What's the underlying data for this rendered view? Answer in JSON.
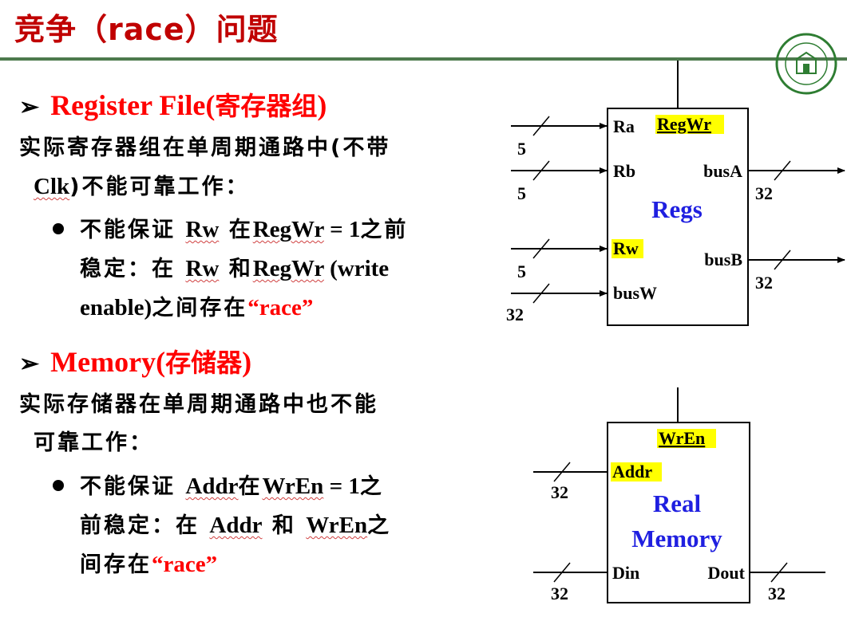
{
  "slide": {
    "title": "竞争（race）问题"
  },
  "sections": [
    {
      "heading_latin": "Register File(",
      "heading_cjk": "寄存器组",
      "heading_close": ")",
      "para_a": "实际寄存器组在单周期通路中(不带",
      "para_b_link": "Clk",
      "para_b_rest": ")不能可靠工作：",
      "bullet": {
        "l1_a": "不能保证 ",
        "l1_b": "Rw",
        "l1_c": " 在",
        "l1_d": "RegWr",
        "l1_e": " = 1",
        "l1_f": "之前",
        "l2_a": "稳定：在 ",
        "l2_b": "Rw",
        "l2_c": " 和",
        "l2_d": "RegWr",
        "l2_e": " (write",
        "l3_a": "enable)",
        "l3_b": "之间存在",
        "l3_c": "“race”"
      }
    },
    {
      "heading_latin": "Memory(",
      "heading_cjk": "存储器",
      "heading_close": ")",
      "para_a": "实际存储器在单周期通路中也不能",
      "para_b": "可靠工作：",
      "bullet": {
        "l1_a": "不能保证 ",
        "l1_b": "Addr",
        "l1_c": "在",
        "l1_d": "WrEn",
        "l1_e": " = 1",
        "l1_f": "之",
        "l2_a": "前稳定：在 ",
        "l2_b": "Addr",
        "l2_c": " 和 ",
        "l2_d": "WrEn",
        "l2_e": "之",
        "l3_a": "间存在",
        "l3_c": "“race”"
      }
    }
  ],
  "regs": {
    "name": "Regs",
    "ports": {
      "ra": "Ra",
      "rb": "Rb",
      "rw": "Rw",
      "busw": "busW",
      "busa": "busA",
      "busb": "busB",
      "regwr": "RegWr"
    },
    "widths": {
      "ra": "5",
      "rb": "5",
      "rw": "5",
      "busw": "32",
      "busa": "32",
      "busb": "32"
    }
  },
  "mem": {
    "name_1": "Real",
    "name_2": "Memory",
    "ports": {
      "addr": "Addr",
      "din": "Din",
      "dout": "Dout",
      "wren": "WrEn"
    },
    "widths": {
      "addr": "32",
      "din": "32",
      "dout": "32"
    }
  },
  "colors": {
    "title": "#c00000",
    "heading": "#ff0000",
    "block_name": "#1f1fe0",
    "highlight": "#ffff00",
    "rule": "#4d7a4d"
  }
}
